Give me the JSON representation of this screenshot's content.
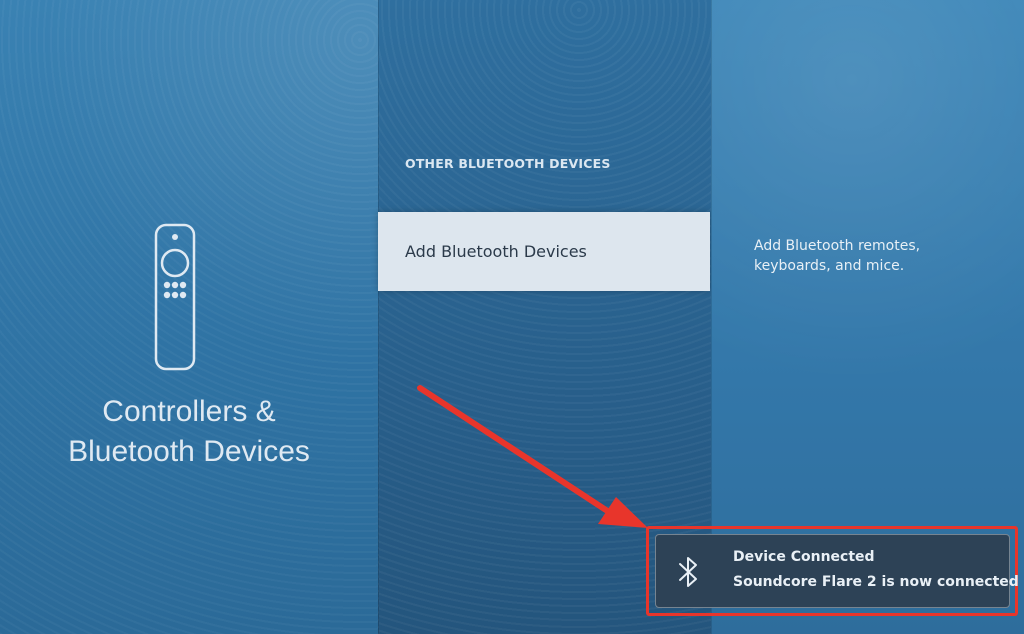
{
  "left_pane": {
    "category_line1": "Controllers &",
    "category_line2": "Bluetooth Devices",
    "icon": "remote-icon"
  },
  "middle_pane": {
    "section_heading": "OTHER BLUETOOTH DEVICES",
    "items": [
      {
        "label": "Add Bluetooth Devices",
        "selected": true
      }
    ]
  },
  "right_pane": {
    "description": "Add Bluetooth remotes, keyboards, and mice."
  },
  "notification": {
    "icon": "bluetooth-icon",
    "title": "Device Connected",
    "message": "Soundcore Flare 2 is now connected"
  },
  "colors": {
    "background": "#2e6f9c",
    "selected_item": "#dde6ee",
    "toast_background": "#2d4256",
    "annotation_red": "#e8352b"
  }
}
